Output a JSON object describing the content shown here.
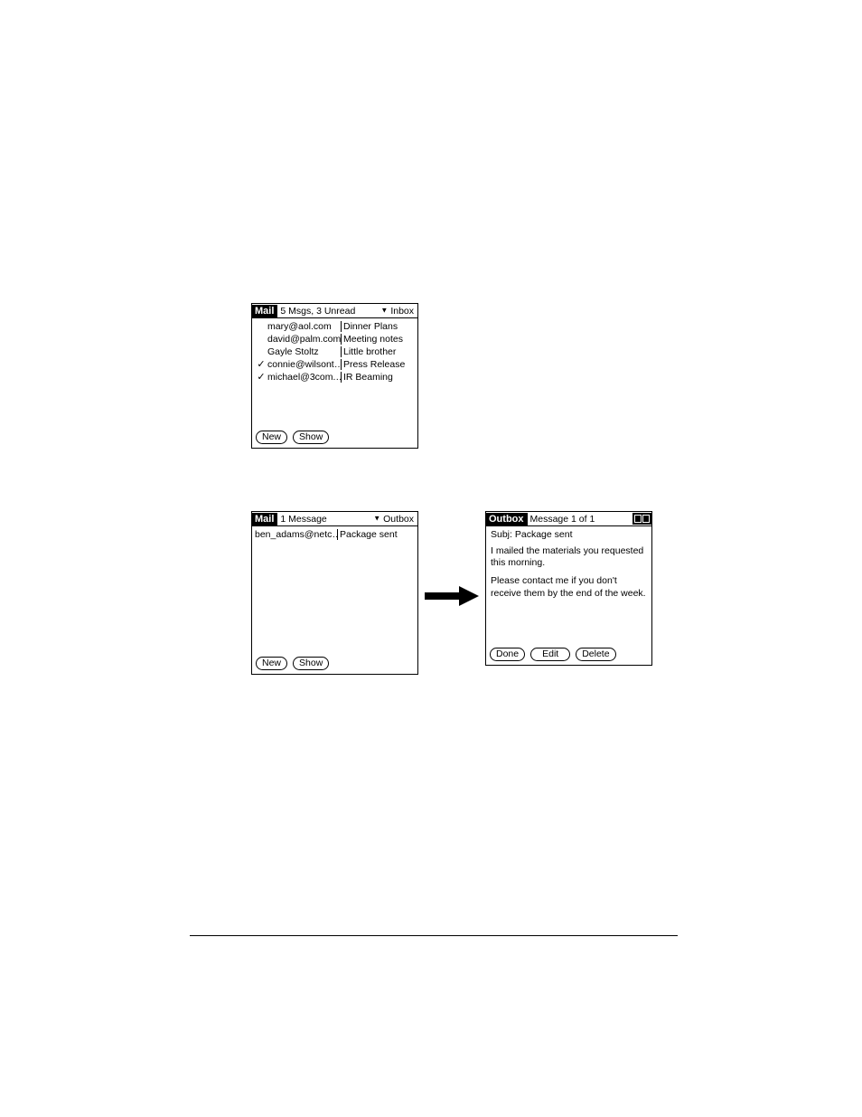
{
  "screen1": {
    "title": "Mail",
    "subhead": "5 Msgs, 3 Unread",
    "menu": "Inbox",
    "messages": [
      {
        "checked": false,
        "sender": "mary@aol.com",
        "subject": "Dinner Plans"
      },
      {
        "checked": false,
        "sender": "david@palm.com",
        "subject": "Meeting notes"
      },
      {
        "checked": false,
        "sender": "Gayle Stoltz",
        "subject": "Little brother"
      },
      {
        "checked": true,
        "sender": "connie@wilsont…",
        "subject": "Press Release"
      },
      {
        "checked": true,
        "sender": "michael@3com.…",
        "subject": "IR Beaming"
      }
    ],
    "btn_new": "New",
    "btn_show": "Show"
  },
  "screen2": {
    "title": "Mail",
    "subhead": "1 Message",
    "menu": "Outbox",
    "message": {
      "sender": "ben_adams@netc…",
      "subject": "Package sent"
    },
    "btn_new": "New",
    "btn_show": "Show"
  },
  "screen3": {
    "title": "Outbox",
    "subhead": "Message 1 of 1",
    "subj_label": "Subj:",
    "subj_value": "Package sent",
    "para1": "I mailed the materials you requested this morning.",
    "para2": "Please contact me if you don't receive them by the end of the week.",
    "btn_done": "Done",
    "btn_edit": "Edit",
    "btn_delete": "Delete"
  }
}
